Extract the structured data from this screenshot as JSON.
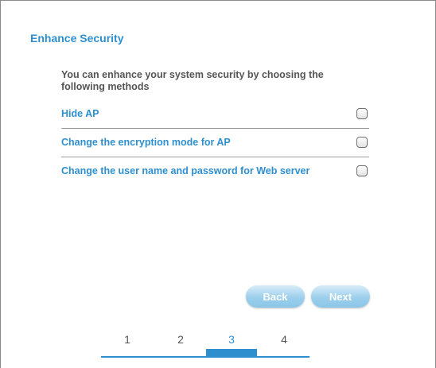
{
  "page": {
    "title": "Enhance Security",
    "intro": "You can enhance your system security by choosing the following methods"
  },
  "options": [
    {
      "label": "Hide AP",
      "checked": false
    },
    {
      "label": "Change the encryption mode for AP",
      "checked": false
    },
    {
      "label": "Change the user name and password for Web server",
      "checked": false
    }
  ],
  "buttons": {
    "back_label": "Back",
    "next_label": "Next"
  },
  "steps": {
    "items": [
      "1",
      "2",
      "3",
      "4"
    ],
    "current": 3
  },
  "colors": {
    "accent": "#2e8fcf",
    "text": "#555555",
    "button": "#9ccfec"
  }
}
